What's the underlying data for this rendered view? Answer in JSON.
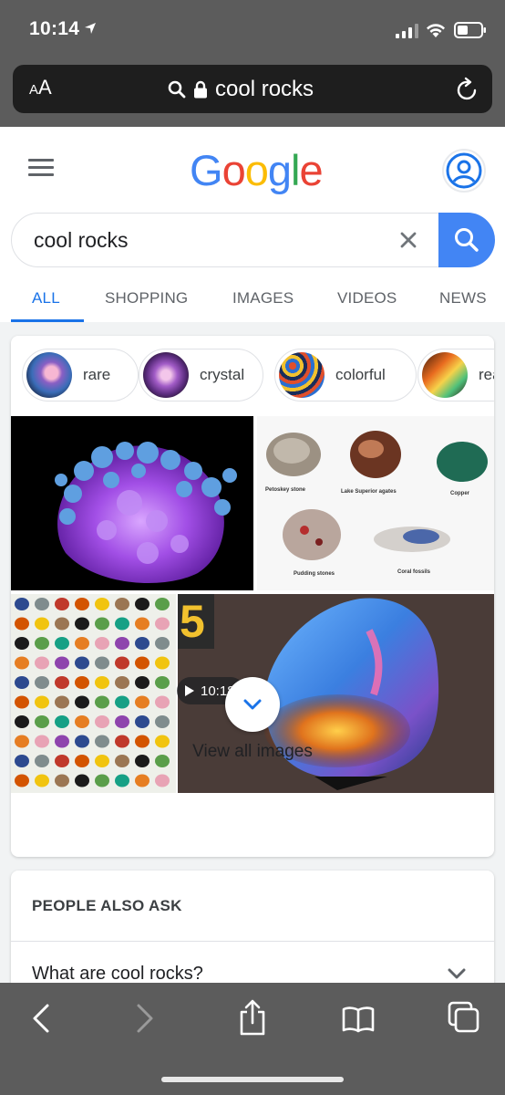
{
  "status_bar": {
    "time": "10:14"
  },
  "browser": {
    "text_size_label_small": "A",
    "text_size_label_large": "A",
    "url_text": "cool rocks"
  },
  "google": {
    "logo_letters": [
      "G",
      "o",
      "o",
      "g",
      "l",
      "e"
    ],
    "logo_colors": [
      "#4285F4",
      "#EA4335",
      "#FBBC05",
      "#4285F4",
      "#34A853",
      "#EA4335"
    ],
    "search_query": "cool rocks",
    "tabs": [
      "ALL",
      "SHOPPING",
      "IMAGES",
      "VIDEOS",
      "NEWS"
    ],
    "active_tab": "ALL",
    "accent_color": "#1a73e8"
  },
  "images": {
    "chips": [
      "rare",
      "crystal",
      "colorful",
      "rea"
    ],
    "panel_labels": [
      "Petoskey stone",
      "Lake Superior agates",
      "Copper",
      "Pudding stones",
      "Coral fossils"
    ],
    "video_duration": "10:18",
    "ranking_number": "5",
    "view_all_label": "View all images"
  },
  "people_also_ask": {
    "title": "PEOPLE ALSO ASK",
    "questions": [
      "What are cool rocks?"
    ]
  }
}
